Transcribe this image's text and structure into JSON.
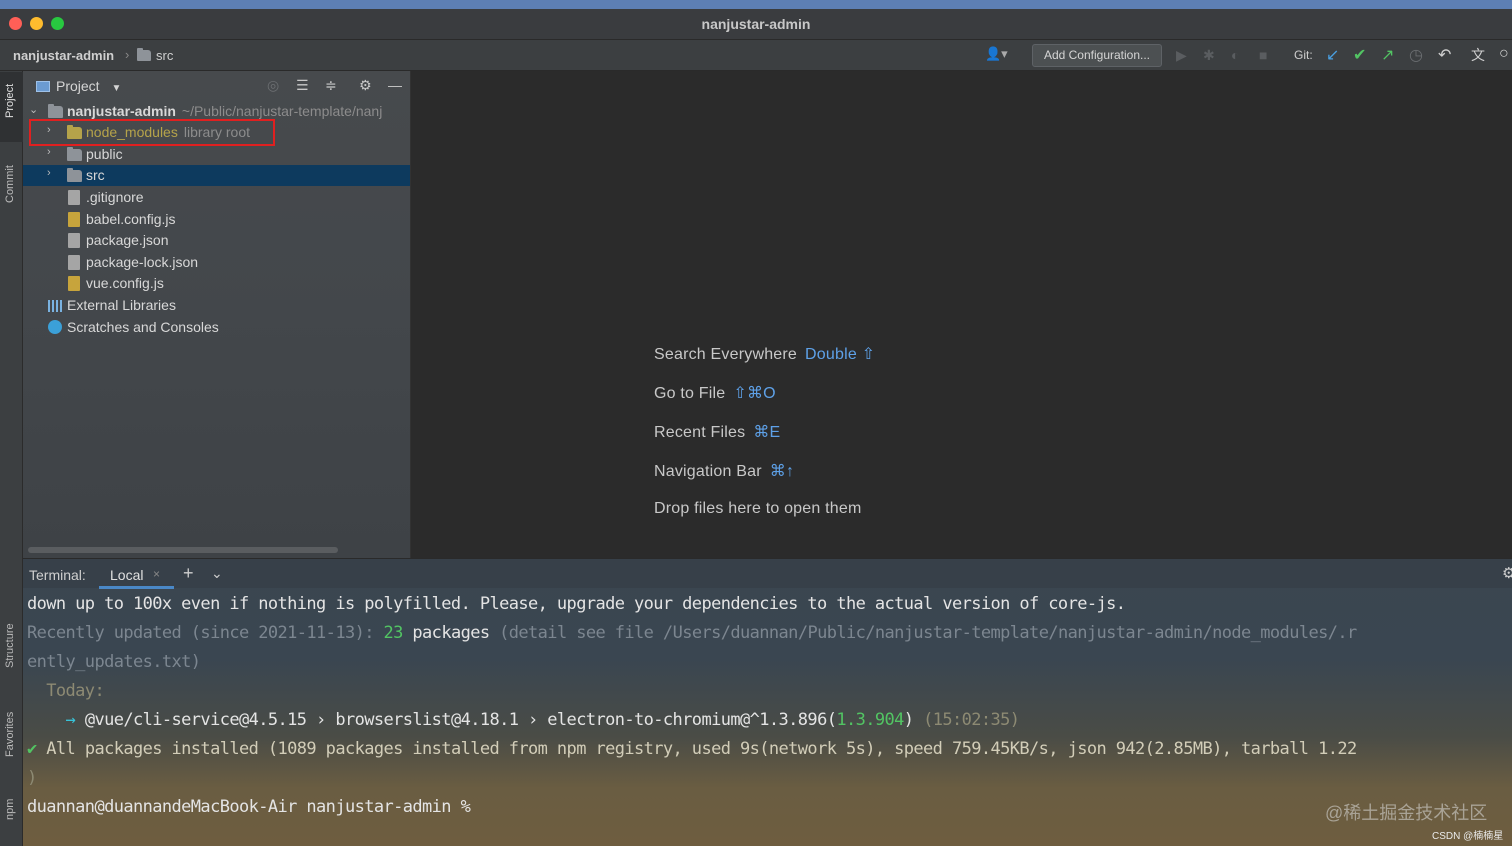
{
  "window": {
    "title": "nanjustar-admin"
  },
  "navbar": {
    "project": "nanjustar-admin",
    "folder": "src",
    "add_configuration": "Add Configuration...",
    "git_label": "Git:"
  },
  "left_stripe": {
    "tabs": [
      "Project",
      "Commit",
      "Structure",
      "Favorites",
      "npm"
    ]
  },
  "project_panel": {
    "title": "Project",
    "root": {
      "name": "nanjustar-admin",
      "path": "~/Public/nanjustar-template/nanj"
    },
    "items": [
      {
        "name": "node_modules",
        "suffix": "library root",
        "type": "folder-library"
      },
      {
        "name": "public",
        "type": "folder"
      },
      {
        "name": "src",
        "type": "folder",
        "selected": true
      },
      {
        "name": ".gitignore",
        "type": "file"
      },
      {
        "name": "babel.config.js",
        "type": "js"
      },
      {
        "name": "package.json",
        "type": "file"
      },
      {
        "name": "package-lock.json",
        "type": "file"
      },
      {
        "name": "vue.config.js",
        "type": "js"
      }
    ],
    "external_libraries": "External Libraries",
    "scratches": "Scratches and Consoles"
  },
  "editor_hints": [
    {
      "label": "Search Everywhere",
      "key": "Double ⇧"
    },
    {
      "label": "Go to File",
      "key": "⇧⌘O"
    },
    {
      "label": "Recent Files",
      "key": "⌘E"
    },
    {
      "label": "Navigation Bar",
      "key": "⌘↑"
    },
    {
      "label": "Drop files here to open them",
      "key": ""
    }
  ],
  "terminal": {
    "title": "Terminal:",
    "tab": "Local",
    "lines": {
      "l1": "down up to 100x even if nothing is polyfilled. Please, upgrade your dependencies to the actual version of core-js.",
      "l2a": "Recently updated (since 2021-11-13): ",
      "l2b": "23",
      "l2c": " packages",
      "l2d": " (detail see file /Users/duannan/Public/nanjustar-template/nanjustar-admin/node_modules/.r",
      "l3": "ently_updates.txt)",
      "l4": "  Today:",
      "l5a": "    → ",
      "l5b": "@vue/cli-service@4.5.15 › browserslist@4.18.1 › electron-to-chromium@^1.3.896(",
      "l5c": "1.3.904",
      "l5d": ")",
      "l5e": " (15:02:35)",
      "l6a": "✔",
      "l6b": " All packages installed (1089 packages installed from npm registry, used 9s(network 5s), speed 759.45KB/s, json 942(2.85MB), tarball 1.22",
      "l7": ")",
      "l8": "duannan@duannandeMacBook-Air nanjustar-admin %"
    }
  },
  "watermark": {
    "main": "@稀土掘金技术社区",
    "small": "CSDN @楠楠星"
  }
}
